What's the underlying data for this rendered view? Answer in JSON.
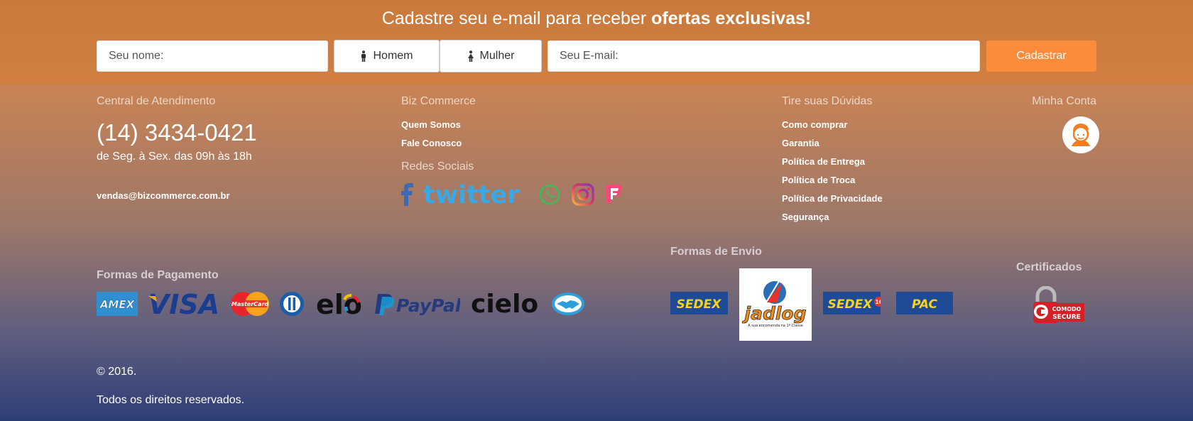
{
  "newsletter": {
    "title_prefix": "Cadastre seu e-mail para receber ",
    "title_bold": "ofertas exclusivas!",
    "name_placeholder": "Seu nome:",
    "male_label": "Homem",
    "female_label": "Mulher",
    "email_placeholder": "Seu E-mail:",
    "submit_label": "Cadastrar"
  },
  "support": {
    "title": "Central de Atendimento",
    "phone": "(14) 3434-0421",
    "hours": "de Seg. à Sex. das 09h às 18h",
    "email": "vendas@bizcommerce.com.br"
  },
  "company": {
    "title": "Biz Commerce",
    "links": [
      "Quem Somos",
      "Fale Conosco"
    ],
    "social_title": "Redes Sociais",
    "social_icons": [
      "facebook-icon",
      "twitter-icon",
      "whatsapp-icon",
      "instagram-icon",
      "foursquare-icon"
    ],
    "twitter_text": "twitter"
  },
  "help": {
    "title": "Tire suas Dúvidas",
    "links": [
      "Como comprar",
      "Garantia",
      "Política de Entrega",
      "Política de Troca",
      "Política de Privacidade",
      "Segurança"
    ]
  },
  "account": {
    "title": "Minha Conta"
  },
  "payment": {
    "title": "Formas de Pagamento",
    "methods": [
      "AMEX",
      "VISA",
      "MasterCard",
      "elo",
      "PayPal",
      "cielo"
    ]
  },
  "shipping": {
    "title": "Formas de Envio",
    "methods": [
      "SEDEX",
      "jadlog",
      "SEDEX",
      "PAC"
    ],
    "jadlog_tagline": "A sua encomenda na 1ª Classe",
    "sedex10_badge": "10"
  },
  "certificates": {
    "title": "Certificados",
    "badge_top": "COMODO",
    "badge_bottom": "SECURE"
  },
  "footer": {
    "copyright": "© 2016.",
    "rights": "Todos os direitos reservados."
  },
  "colors": {
    "accent": "#fb8c3b",
    "sedex_blue": "#1e4a96",
    "sedex_yellow": "#f7d21c"
  }
}
